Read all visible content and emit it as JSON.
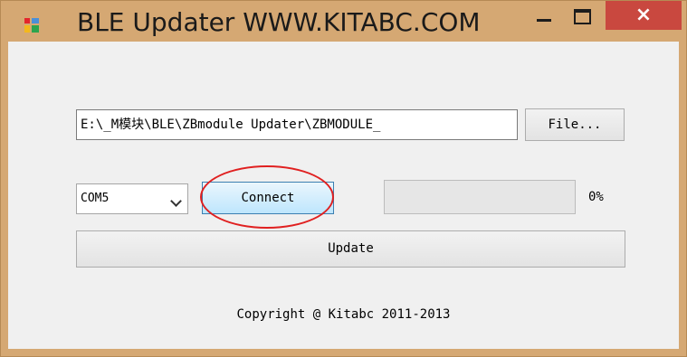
{
  "window": {
    "title": "BLE Updater WWW.KITABC.COM",
    "app_icon": "app-window-icon",
    "controls": {
      "minimize": "minimize-icon",
      "maximize": "maximize-icon",
      "close": "×"
    }
  },
  "file": {
    "path": "E:\\_M模块\\BLE\\ZBmodule Updater\\ZBMODULE_",
    "button_label": "File..."
  },
  "port": {
    "selected": "COM5"
  },
  "connect": {
    "label": "Connect"
  },
  "progress": {
    "value": 0,
    "label": "0%"
  },
  "update": {
    "label": "Update"
  },
  "footer": {
    "copyright": "Copyright @ Kitabc 2011-2013"
  },
  "colors": {
    "titlebar": "#d5a873",
    "close_button": "#c9483f",
    "client_bg": "#f0f0f0",
    "highlight": "#e02020"
  }
}
